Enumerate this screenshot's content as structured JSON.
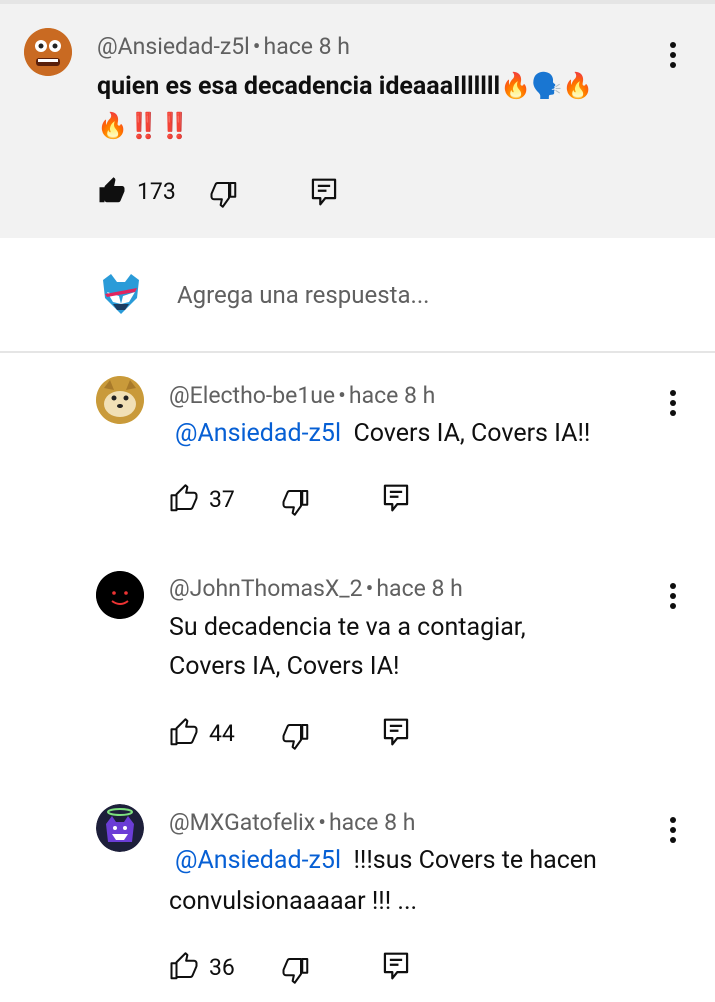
{
  "main_comment": {
    "author": "@Ansiedad-z5l",
    "time": "hace 8 h",
    "text_line1": "quien es esa decadencia ideaaaIllllll🔥🗣️🔥",
    "text_line2": "🔥‼️‼️",
    "likes": "173"
  },
  "reply_box": {
    "placeholder": "Agrega una respuesta..."
  },
  "replies": [
    {
      "author": "@Electho-be1ue",
      "time": "hace 8 h",
      "mention": "@Ansiedad-z5l",
      "text": "Covers IA, Covers IA!!",
      "likes": "37"
    },
    {
      "author": "@JohnThomasX_2",
      "time": "hace 8 h",
      "line1": "Su decadencia te va a contagiar,",
      "line2": "Covers IA, Covers IA!",
      "likes": "44"
    },
    {
      "author": "@MXGatofelix",
      "time": "hace 8 h",
      "mention": "@Ansiedad-z5l",
      "text": "!!!sus Covers te hacen",
      "line2": "convulsionaaaaar !!! ...",
      "likes": "36"
    }
  ],
  "separator": "•",
  "colors": {
    "mention": "#065fd4",
    "highlight_bg": "#f2f2f2",
    "meta": "#606060"
  }
}
